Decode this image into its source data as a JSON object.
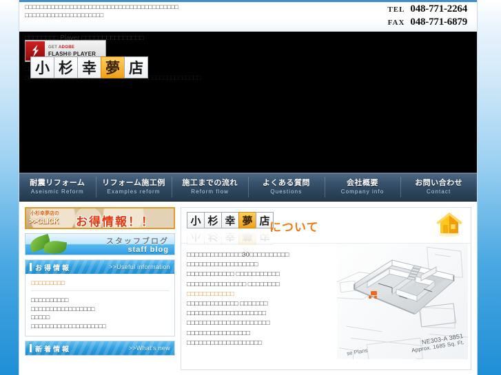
{
  "header": {
    "description_line1": "□□□□□□□□□□□□□□□□□□□□□□□□□□□□□□□□□□□□□□□□□",
    "description_line2": "□□□□□□□□□□□□□□□□□□□□□",
    "tel_label": "TEL",
    "tel_number": "048-771-2264",
    "fax_label": "FAX",
    "fax_number": "048-771-6879"
  },
  "logo": {
    "chars": [
      "小",
      "杉",
      "幸",
      "夢",
      "店"
    ],
    "accent_index": 3,
    "accent_color": "#f0a018"
  },
  "hero": {
    "flash_notice": "□□□□□□□□ Player □□□□□□□□□□□□□□□",
    "flash_badge": {
      "get": "GET",
      "adobe": "ADOBE",
      "player": "FLASH® PLAYER"
    },
    "text_line1": "□□□□□□□□□□□□□□□□□□",
    "text_line2": "□□□□□□□□□□□□□□□□□□□□□□□□□□□□□□□□□□□□□□□□□□□□□□□"
  },
  "nav": {
    "items": [
      {
        "ja": "耐震リフォーム",
        "en": "Aseismic Reform"
      },
      {
        "ja": "リフォーム施工例",
        "en": "Examples reform"
      },
      {
        "ja": "施工までの流れ",
        "en": "Reform flow"
      },
      {
        "ja": "よくある質問",
        "en": "Questions"
      },
      {
        "ja": "会社概要",
        "en": "Company info"
      },
      {
        "ja": "お問い合わせ",
        "en": "Contact"
      }
    ]
  },
  "sidebar": {
    "deal_banner": {
      "small": "小杉幸夢店の",
      "click": ">>CLICK",
      "big": "お得情報！！"
    },
    "blog_banner": {
      "ja": "スタッフブログ",
      "en": "staff blog"
    },
    "useful": {
      "head_ja": "お得情報",
      "head_en": ">>Useful information",
      "link": "□□□□□□□□□",
      "lines": [
        "□□□□□□□□□□",
        "□□□□□□□□□□□□□□□□□",
        "□□□□□",
        "□□□□□□□□□□□□□□□□□□□□"
      ]
    },
    "news": {
      "head_ja": "新着情報",
      "head_en": ">>What's new"
    }
  },
  "main": {
    "title_chars": [
      "小",
      "杉",
      "幸",
      "夢",
      "店"
    ],
    "title_accent_index": 3,
    "title_suffix": "について",
    "body_lines": [
      {
        "text": "□□□□□□□□□□□□□□30□□□□□□□□□□",
        "highlight": false
      },
      {
        "text": "□□□□□□□□□□□□□□□□□□",
        "highlight": false
      },
      {
        "text": "□□□□□□□□□□□□ □□□□□□□□□□□",
        "highlight": false
      },
      {
        "text": "□□□□□□□□□□□□□□□ □□□□□□□□",
        "highlight": false
      },
      {
        "text": "□□□□□□□□□□□□",
        "highlight": true
      },
      {
        "text": "□□□□□□□□□□□□□ □□□□□□□",
        "highlight": false
      },
      {
        "text": "□□□□□□□□□□□□□□□□□□□□",
        "highlight": false
      },
      {
        "text": "□□□□□□□□□□□□□□□□□□□□□",
        "highlight": false
      },
      {
        "text": "□□□□□□□□□□□□□□□□",
        "highlight": false
      },
      {
        "text": "□□□□□□□□□□□□□□□□□□□",
        "highlight": false
      }
    ],
    "floorplan": {
      "label_line1": "NE303-A  3851",
      "label_line2": "Approx. 1685 Sq. Ft.",
      "label_corner": "se Plans"
    }
  }
}
